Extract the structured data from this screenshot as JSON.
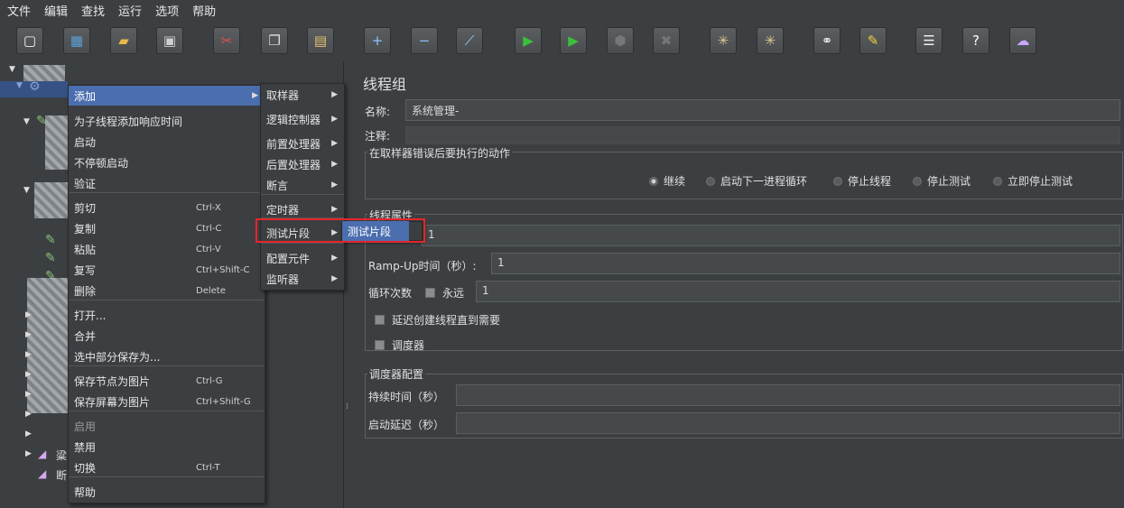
{
  "menubar": [
    "文件",
    "编辑",
    "查找",
    "运行",
    "选项",
    "帮助"
  ],
  "toolbar": {
    "buttons": [
      {
        "name": "new-icon",
        "glyph": "▢",
        "color": "#f5f5f0"
      },
      {
        "name": "templates-icon",
        "glyph": "▦",
        "color": "#5aa0d8"
      },
      {
        "name": "open-icon",
        "glyph": "▰",
        "color": "#e8b84a"
      },
      {
        "name": "save-icon",
        "glyph": "▣",
        "color": "#d0d0d0"
      },
      {
        "name": "cut-icon",
        "glyph": "✂",
        "color": "#e05050"
      },
      {
        "name": "copy-icon",
        "glyph": "❐",
        "color": "#e0e0e0"
      },
      {
        "name": "paste-icon",
        "glyph": "▤",
        "color": "#e8c070"
      },
      {
        "name": "expand-icon",
        "glyph": "+",
        "color": "#8fc0ff"
      },
      {
        "name": "collapse-icon",
        "glyph": "−",
        "color": "#8fc0ff"
      },
      {
        "name": "toggle-icon",
        "glyph": "⟋",
        "color": "#9ad0ff"
      },
      {
        "name": "start-icon",
        "glyph": "▶",
        "color": "#3ac13a"
      },
      {
        "name": "start-no-pause-icon",
        "glyph": "▶",
        "color": "#3ac13a"
      },
      {
        "name": "stop-icon",
        "glyph": "⬢",
        "color": "#777"
      },
      {
        "name": "shutdown-icon",
        "glyph": "✖",
        "color": "#777"
      },
      {
        "name": "clear-icon",
        "glyph": "✳",
        "color": "#e0c890"
      },
      {
        "name": "clear-all-icon",
        "glyph": "✳",
        "color": "#e0c890"
      },
      {
        "name": "search-icon",
        "glyph": "⚭",
        "color": "#eeeeee"
      },
      {
        "name": "reset-search-icon",
        "glyph": "✎",
        "color": "#f0d040"
      },
      {
        "name": "function-helper-icon",
        "glyph": "☰",
        "color": "#eeeeee"
      },
      {
        "name": "help-icon",
        "glyph": "?",
        "color": "#ffffff"
      },
      {
        "name": "remote-icon",
        "glyph": "☁",
        "color": "#c8a8ff"
      }
    ]
  },
  "tree": {
    "visible_fragments": [
      "粱",
      "断"
    ]
  },
  "context_menu": {
    "items": [
      {
        "label": "添加",
        "shortcut": "",
        "arrow": true,
        "selected": true,
        "disabled": false
      },
      {
        "label": "为子线程添加响应时间",
        "shortcut": "",
        "arrow": false,
        "selected": false,
        "disabled": false
      },
      {
        "label": "启动",
        "shortcut": "",
        "arrow": false,
        "selected": false,
        "disabled": false
      },
      {
        "label": "不停顿启动",
        "shortcut": "",
        "arrow": false,
        "selected": false,
        "disabled": false
      },
      {
        "label": "验证",
        "shortcut": "",
        "arrow": false,
        "selected": false,
        "disabled": false
      },
      {
        "label": "剪切",
        "shortcut": "Ctrl-X",
        "arrow": false,
        "selected": false,
        "disabled": false
      },
      {
        "label": "复制",
        "shortcut": "Ctrl-C",
        "arrow": false,
        "selected": false,
        "disabled": false
      },
      {
        "label": "粘贴",
        "shortcut": "Ctrl-V",
        "arrow": false,
        "selected": false,
        "disabled": false
      },
      {
        "label": "复写",
        "shortcut": "Ctrl+Shift-C",
        "arrow": false,
        "selected": false,
        "disabled": false
      },
      {
        "label": "删除",
        "shortcut": "Delete",
        "arrow": false,
        "selected": false,
        "disabled": false
      },
      {
        "label": "打开...",
        "shortcut": "",
        "arrow": false,
        "selected": false,
        "disabled": false
      },
      {
        "label": "合并",
        "shortcut": "",
        "arrow": false,
        "selected": false,
        "disabled": false
      },
      {
        "label": "选中部分保存为...",
        "shortcut": "",
        "arrow": false,
        "selected": false,
        "disabled": false
      },
      {
        "label": "保存节点为图片",
        "shortcut": "Ctrl-G",
        "arrow": false,
        "selected": false,
        "disabled": false
      },
      {
        "label": "保存屏幕为图片",
        "shortcut": "Ctrl+Shift-G",
        "arrow": false,
        "selected": false,
        "disabled": false
      },
      {
        "label": "启用",
        "shortcut": "",
        "arrow": false,
        "selected": false,
        "disabled": true
      },
      {
        "label": "禁用",
        "shortcut": "",
        "arrow": false,
        "selected": false,
        "disabled": false
      },
      {
        "label": "切换",
        "shortcut": "Ctrl-T",
        "arrow": false,
        "selected": false,
        "disabled": false
      },
      {
        "label": "帮助",
        "shortcut": "",
        "arrow": false,
        "selected": false,
        "disabled": false
      }
    ]
  },
  "add_submenu": {
    "items": [
      "取样器",
      "逻辑控制器",
      "前置处理器",
      "后置处理器",
      "断言",
      "定时器",
      "测试片段",
      "配置元件",
      "监听器"
    ]
  },
  "fragment_submenu": {
    "items": [
      "测试片段"
    ]
  },
  "panel": {
    "title": "线程组",
    "name_label": "名称:",
    "name_value": "系统管理-",
    "comment_label": "注释:",
    "comment_value": "",
    "error_action": {
      "title": "在取样器错误后要执行的动作",
      "options": [
        {
          "label": "继续",
          "checked": true
        },
        {
          "label": "启动下一进程循环",
          "checked": false
        },
        {
          "label": "停止线程",
          "checked": false
        },
        {
          "label": "停止测试",
          "checked": false
        },
        {
          "label": "立即停止测试",
          "checked": false
        }
      ]
    },
    "thread_props": {
      "title": "线程属性",
      "threads_value": "1",
      "rampup_label": "Ramp-Up时间（秒）:",
      "rampup_value": "1",
      "loop_label": "循环次数",
      "forever_label": "永远",
      "loop_value": "1",
      "delay_label": "延迟创建线程直到需要",
      "scheduler_label": "调度器"
    },
    "scheduler_config": {
      "title": "调度器配置",
      "duration_label": "持续时间（秒）",
      "duration_value": "",
      "startup_delay_label": "启动延迟（秒）",
      "startup_delay_value": ""
    }
  }
}
